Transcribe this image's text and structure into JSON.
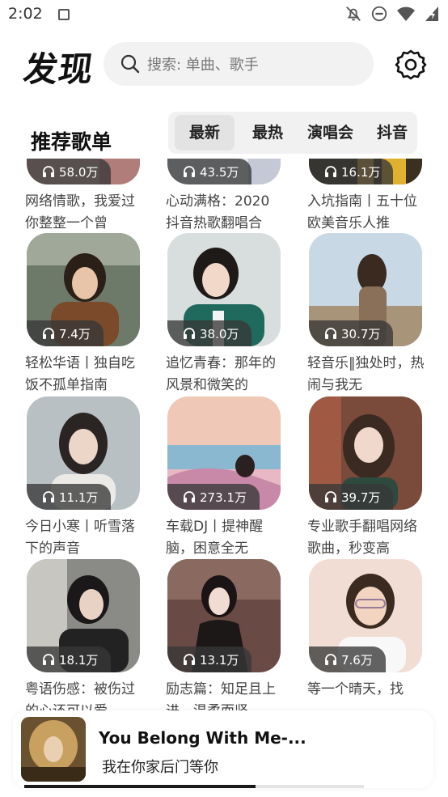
{
  "status_bar": {
    "time": "2:02"
  },
  "header": {
    "title": "发现",
    "search_placeholder": "搜索: 单曲、歌手"
  },
  "section": {
    "title": "推荐歌单"
  },
  "tabs": [
    {
      "label": "最新",
      "active": true
    },
    {
      "label": "最热",
      "active": false
    },
    {
      "label": "演唱会",
      "active": false
    },
    {
      "label": "抖音",
      "active": false
    }
  ],
  "playlists": [
    {
      "plays": "58.0万",
      "title": "网络情歌，我爱过你整整一个曾"
    },
    {
      "plays": "43.5万",
      "title": "心动满格：2020抖音热歌翻唱合"
    },
    {
      "plays": "16.1万",
      "title": "入坑指南丨五十位欧美音乐人推"
    },
    {
      "plays": "7.4万",
      "title": "轻松华语丨独自吃饭不孤单指南"
    },
    {
      "plays": "38.0万",
      "title": "追忆青春：那年的风景和微笑的"
    },
    {
      "plays": "30.7万",
      "title": "轻音乐‖独处时，热闹与我无"
    },
    {
      "plays": "11.1万",
      "title": "今日小寒丨听雪落下的声音"
    },
    {
      "plays": "273.1万",
      "title": "车载DJ丨提神醒脑，困意全无"
    },
    {
      "plays": "39.7万",
      "title": "专业歌手翻唱网络歌曲，秒变高"
    },
    {
      "plays": "18.1万",
      "title": "粤语伤感：被伤过的心还可以爱"
    },
    {
      "plays": "13.1万",
      "title": "励志篇：知足且上进，温柔而坚"
    },
    {
      "plays": "7.6万",
      "title": "等一个晴天，找"
    }
  ],
  "player": {
    "song": "You Belong With Me-...",
    "subtitle": "我在你家后门等你",
    "progress": 0.68
  },
  "colors": {
    "accent": "#111111",
    "badge_bg": "#373737",
    "search_bg": "#f2f2f2"
  }
}
